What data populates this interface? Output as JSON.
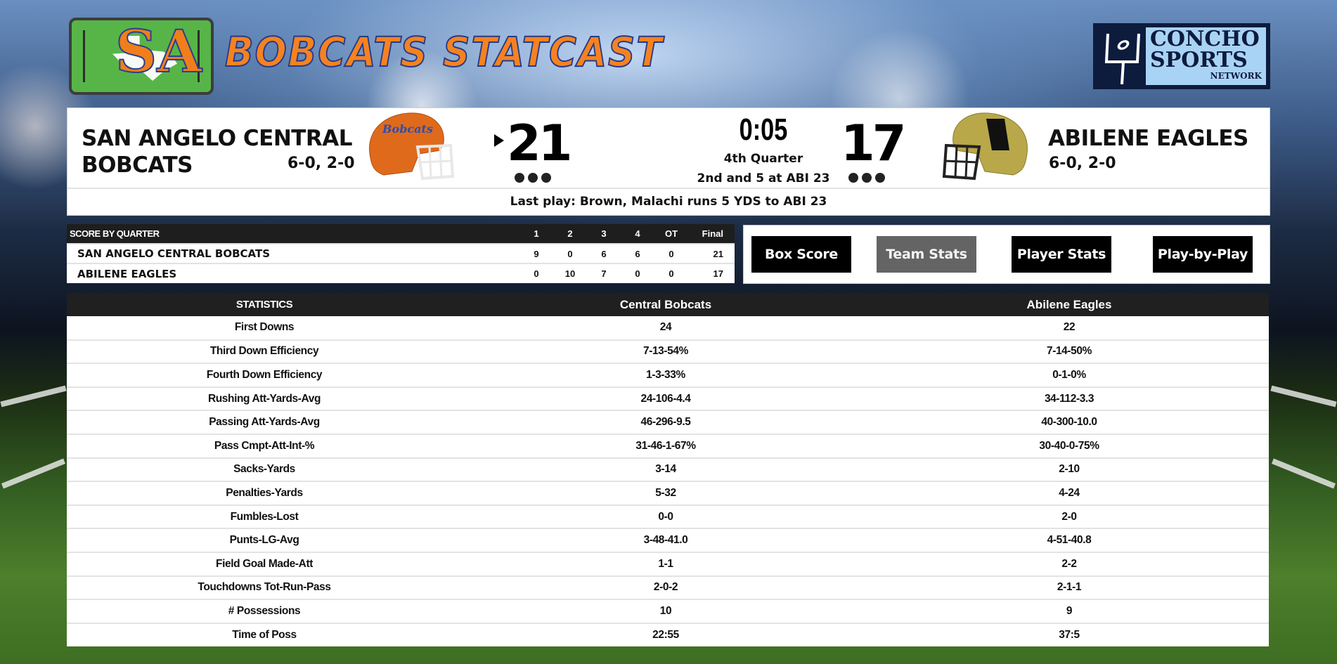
{
  "header": {
    "title": "BOBCATS STATCAST",
    "logo_left_alt": "SA",
    "network_logo": {
      "line1": "CONCHO",
      "line2": "SPORTS",
      "line3": "NETWORK"
    }
  },
  "scoreboard": {
    "home": {
      "name_line1": "SAN ANGELO CENTRAL",
      "name_line2": "BOBCATS",
      "record": "6-0, 2-0",
      "score": "21",
      "timeouts_remaining": 3,
      "has_possession": true,
      "helmet_color": "#e06a1c"
    },
    "away": {
      "name": "ABILENE EAGLES",
      "record": "6-0, 2-0",
      "score": "17",
      "timeouts_remaining": 3,
      "has_possession": false,
      "helmet_color": "#b8a84a"
    },
    "clock": "0:05",
    "quarter": "4th Quarter",
    "down_distance": "2nd and 5 at ABI 23",
    "last_play": "Last play: Brown, Malachi runs 5 YDS to ABI 23"
  },
  "score_by_quarter": {
    "title": "SCORE BY QUARTER",
    "columns": [
      "1",
      "2",
      "3",
      "4",
      "OT",
      "Final"
    ],
    "rows": [
      {
        "team": "SAN ANGELO CENTRAL BOBCATS",
        "scores": [
          "9",
          "0",
          "6",
          "6",
          "0",
          "21"
        ]
      },
      {
        "team": "ABILENE EAGLES",
        "scores": [
          "0",
          "10",
          "7",
          "0",
          "0",
          "17"
        ]
      }
    ]
  },
  "nav": {
    "buttons": [
      {
        "label": "Box Score",
        "active": false
      },
      {
        "label": "Team Stats",
        "active": true
      },
      {
        "label": "Player Stats",
        "active": false
      },
      {
        "label": "Play-by-Play",
        "active": false
      }
    ]
  },
  "stats": {
    "headers": [
      "STATISTICS",
      "Central Bobcats",
      "Abilene Eagles"
    ],
    "rows": [
      {
        "label": "First Downs",
        "home": "24",
        "away": "22"
      },
      {
        "label": "Third Down Efficiency",
        "home": "7-13-54%",
        "away": "7-14-50%"
      },
      {
        "label": "Fourth Down Efficiency",
        "home": "1-3-33%",
        "away": "0-1-0%"
      },
      {
        "label": "Rushing Att-Yards-Avg",
        "home": "24-106-4.4",
        "away": "34-112-3.3"
      },
      {
        "label": "Passing Att-Yards-Avg",
        "home": "46-296-9.5",
        "away": "40-300-10.0"
      },
      {
        "label": "Pass Cmpt-Att-Int-%",
        "home": "31-46-1-67%",
        "away": "30-40-0-75%"
      },
      {
        "label": "Sacks-Yards",
        "home": "3-14",
        "away": "2-10"
      },
      {
        "label": "Penalties-Yards",
        "home": "5-32",
        "away": "4-24"
      },
      {
        "label": "Fumbles-Lost",
        "home": "0-0",
        "away": "2-0"
      },
      {
        "label": "Punts-LG-Avg",
        "home": "3-48-41.0",
        "away": "4-51-40.8"
      },
      {
        "label": "Field Goal Made-Att",
        "home": "1-1",
        "away": "2-2"
      },
      {
        "label": "Touchdowns Tot-Run-Pass",
        "home": "2-0-2",
        "away": "2-1-1"
      },
      {
        "label": "# Possessions",
        "home": "10",
        "away": "9"
      },
      {
        "label": "Time of Poss",
        "home": "22:55",
        "away": "37:5"
      }
    ]
  },
  "colors": {
    "title_orange": "#f58220",
    "title_outline": "#253a8a",
    "logo_green": "#57b548",
    "network_navy": "#0d1b3d",
    "network_light_blue": "#a9d3f5",
    "table_header": "#202020",
    "active_button": "#646464"
  }
}
